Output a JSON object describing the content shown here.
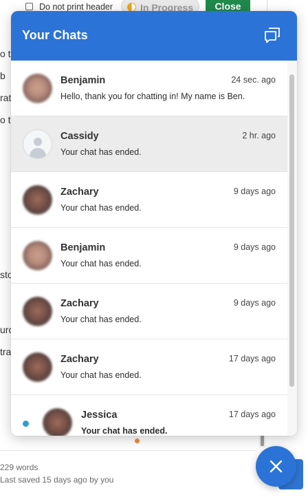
{
  "background_page": {
    "checkbox_label": "Do not print header",
    "status_label": "In Progress",
    "close_button_label": "Close",
    "text_fragments": [
      "o t",
      "b",
      "rat",
      "o t",
      "sto",
      "urc",
      "tra"
    ],
    "word_count": "229 words",
    "last_saved": "Last saved 15 days ago by you",
    "status_color": "#f0a31a",
    "close_button_color": "#1f8a4c"
  },
  "chat_widget": {
    "title": "Your Chats",
    "accent_color": "#2c73d7",
    "header_icon": "new-chat-icon",
    "launcher_icon": "close-icon",
    "chats": [
      {
        "name": "Benjamin",
        "time": "24 sec. ago",
        "message": "Hello, thank you for chatting in! My name is Ben."
      },
      {
        "name": "Cassidy",
        "time": "2 hr. ago",
        "message": "Your chat has ended."
      },
      {
        "name": "Zachary",
        "time": "9 days ago",
        "message": "Your chat has ended."
      },
      {
        "name": "Benjamin",
        "time": "9 days ago",
        "message": "Your chat has ended."
      },
      {
        "name": "Zachary",
        "time": "9 days ago",
        "message": "Your chat has ended."
      },
      {
        "name": "Zachary",
        "time": "17 days ago",
        "message": "Your chat has ended."
      },
      {
        "name": "Jessica",
        "time": "17 days ago",
        "message": "Your chat has ended."
      }
    ]
  }
}
